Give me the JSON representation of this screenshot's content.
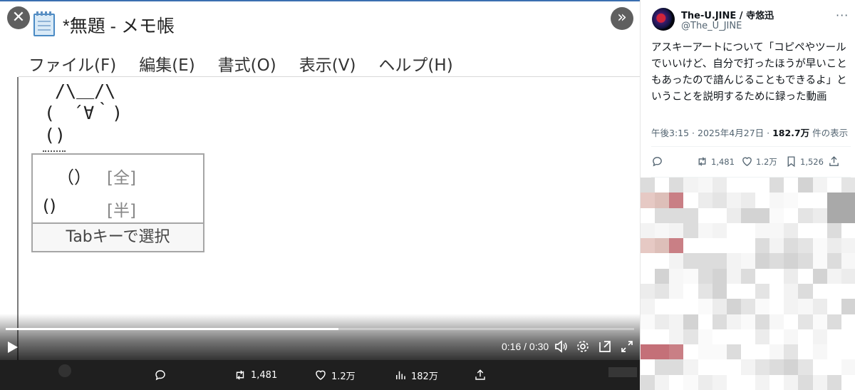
{
  "video": {
    "notepad": {
      "title": "*無題 - メモ帳",
      "menu": [
        "ファイル(F)",
        "編集(E)",
        "書式(O)",
        "表示(V)",
        "ヘルプ(H)"
      ],
      "ascii_art": " /\\＿/\\\n(　´∀｀)\n()",
      "ime": {
        "candidates": [
          {
            "text": "（）",
            "tag": "[全]"
          },
          {
            "text": "()",
            "tag": "[半]"
          }
        ],
        "footer": "Tabキーで選択"
      }
    },
    "controls": {
      "time": "0:16 / 0:30",
      "progress": 0.53,
      "close_icon": "close-icon",
      "expand_icon": "chevrons-right-icon"
    },
    "actions": {
      "reply": "",
      "retweets": "1,481",
      "likes": "1.2万",
      "views": "182万",
      "share": ""
    }
  },
  "tweet": {
    "display_name": "The-U.JINE / 寺悠迅",
    "handle": "@The_U_JINE",
    "more": "···",
    "text": "アスキーアートについて「コピペやツールでいいけど、自分で打ったほうが早いこともあったので諳んじることもできるよ」ということを説明するために録った動画",
    "meta": {
      "time": "午後3:15 · 2025年4月27日 · ",
      "views_count": "182.7万",
      "views_suffix": " 件の表示"
    },
    "stats": {
      "retweets": "1,481",
      "likes": "1.2万",
      "bookmarks": "1,526"
    }
  }
}
